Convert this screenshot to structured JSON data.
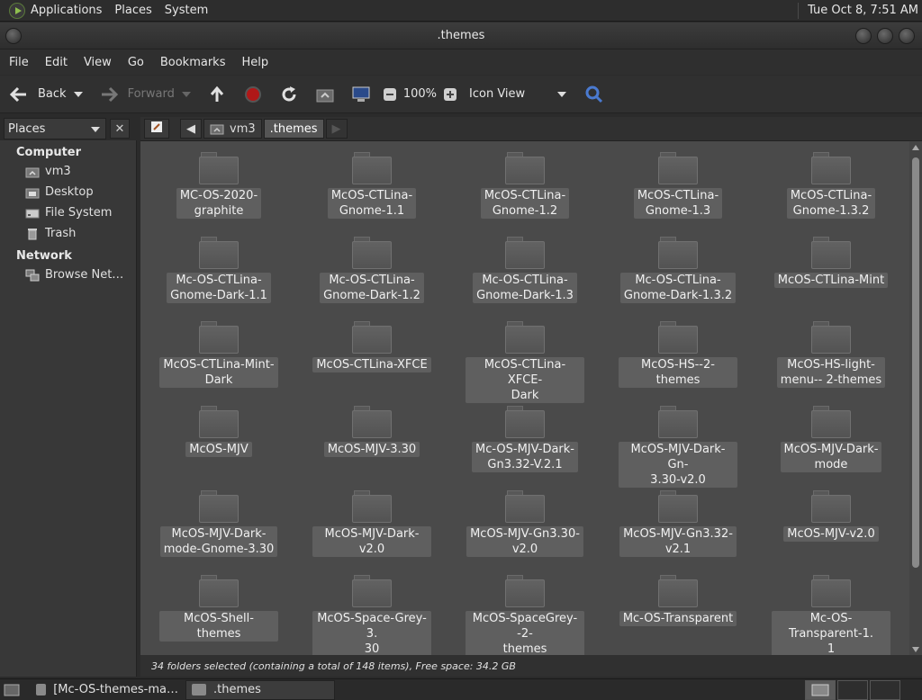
{
  "top_panel": {
    "menus": [
      "Applications",
      "Places",
      "System"
    ],
    "clock": "Tue Oct  8,  7:51 AM"
  },
  "window": {
    "title": ".themes"
  },
  "menubar": [
    "File",
    "Edit",
    "View",
    "Go",
    "Bookmarks",
    "Help"
  ],
  "toolbar": {
    "back_label": "Back",
    "forward_label": "Forward",
    "zoom": "100%",
    "view_mode": "Icon View"
  },
  "sidebar": {
    "dropdown": "Places",
    "sections": [
      {
        "title": "Computer",
        "items": [
          {
            "label": "vm3",
            "icon": "home-folder-icon"
          },
          {
            "label": "Desktop",
            "icon": "desktop-folder-icon"
          },
          {
            "label": "File System",
            "icon": "drive-icon"
          },
          {
            "label": "Trash",
            "icon": "trash-icon"
          }
        ]
      },
      {
        "title": "Network",
        "items": [
          {
            "label": "Browse Net…",
            "icon": "network-icon"
          }
        ]
      }
    ]
  },
  "pathbar": {
    "segments": [
      "vm3",
      ".themes"
    ],
    "active": ".themes"
  },
  "folders": [
    [
      "MC-OS-2020-",
      "graphite"
    ],
    [
      "McOS-CTLina-",
      "Gnome-1.1"
    ],
    [
      "McOS-CTLina-",
      "Gnome-1.2"
    ],
    [
      "McOS-CTLina-",
      "Gnome-1.3"
    ],
    [
      "McOS-CTLina-",
      "Gnome-1.3.2"
    ],
    [
      "Mc-OS-CTLina-",
      "Gnome-Dark-1.1"
    ],
    [
      "Mc-OS-CTLina-",
      "Gnome-Dark-1.2"
    ],
    [
      "Mc-OS-CTLina-",
      "Gnome-Dark-1.3"
    ],
    [
      "Mc-OS-CTLina-",
      "Gnome-Dark-1.3.2"
    ],
    [
      "McOS-CTLina-Mint"
    ],
    [
      "McOS-CTLina-Mint-",
      "Dark"
    ],
    [
      "McOS-CTLina-XFCE"
    ],
    [
      "McOS-CTLina-XFCE-",
      "Dark"
    ],
    [
      "McOS-HS--2-themes"
    ],
    [
      "McOS-HS-light-",
      "menu-- 2-themes"
    ],
    [
      "McOS-MJV"
    ],
    [
      "McOS-MJV-3.30"
    ],
    [
      "Mc-OS-MJV-Dark-",
      "Gn3.32-V.2.1"
    ],
    [
      "McOS-MJV-Dark-Gn-",
      "3.30-v2.0"
    ],
    [
      "McOS-MJV-Dark-",
      "mode"
    ],
    [
      "McOS-MJV-Dark-",
      "mode-Gnome-3.30"
    ],
    [
      "McOS-MJV-Dark-v2.0"
    ],
    [
      "McOS-MJV-Gn3.30-",
      "v2.0"
    ],
    [
      "McOS-MJV-Gn3.32-",
      "v2.1"
    ],
    [
      "McOS-MJV-v2.0"
    ],
    [
      "McOS-Shell-themes"
    ],
    [
      "McOS-Space-Grey-3.",
      "30"
    ],
    [
      "McOS-SpaceGrey--2-",
      "themes"
    ],
    [
      "Mc-OS-Transparent"
    ],
    [
      "Mc-OS-Transparent-1.",
      "1"
    ]
  ],
  "status": "34 folders selected (containing a total of 148 items), Free space: 34.2 GB",
  "taskbar": {
    "tasks": [
      "[Mc-OS-themes-ma…",
      ".themes"
    ]
  }
}
